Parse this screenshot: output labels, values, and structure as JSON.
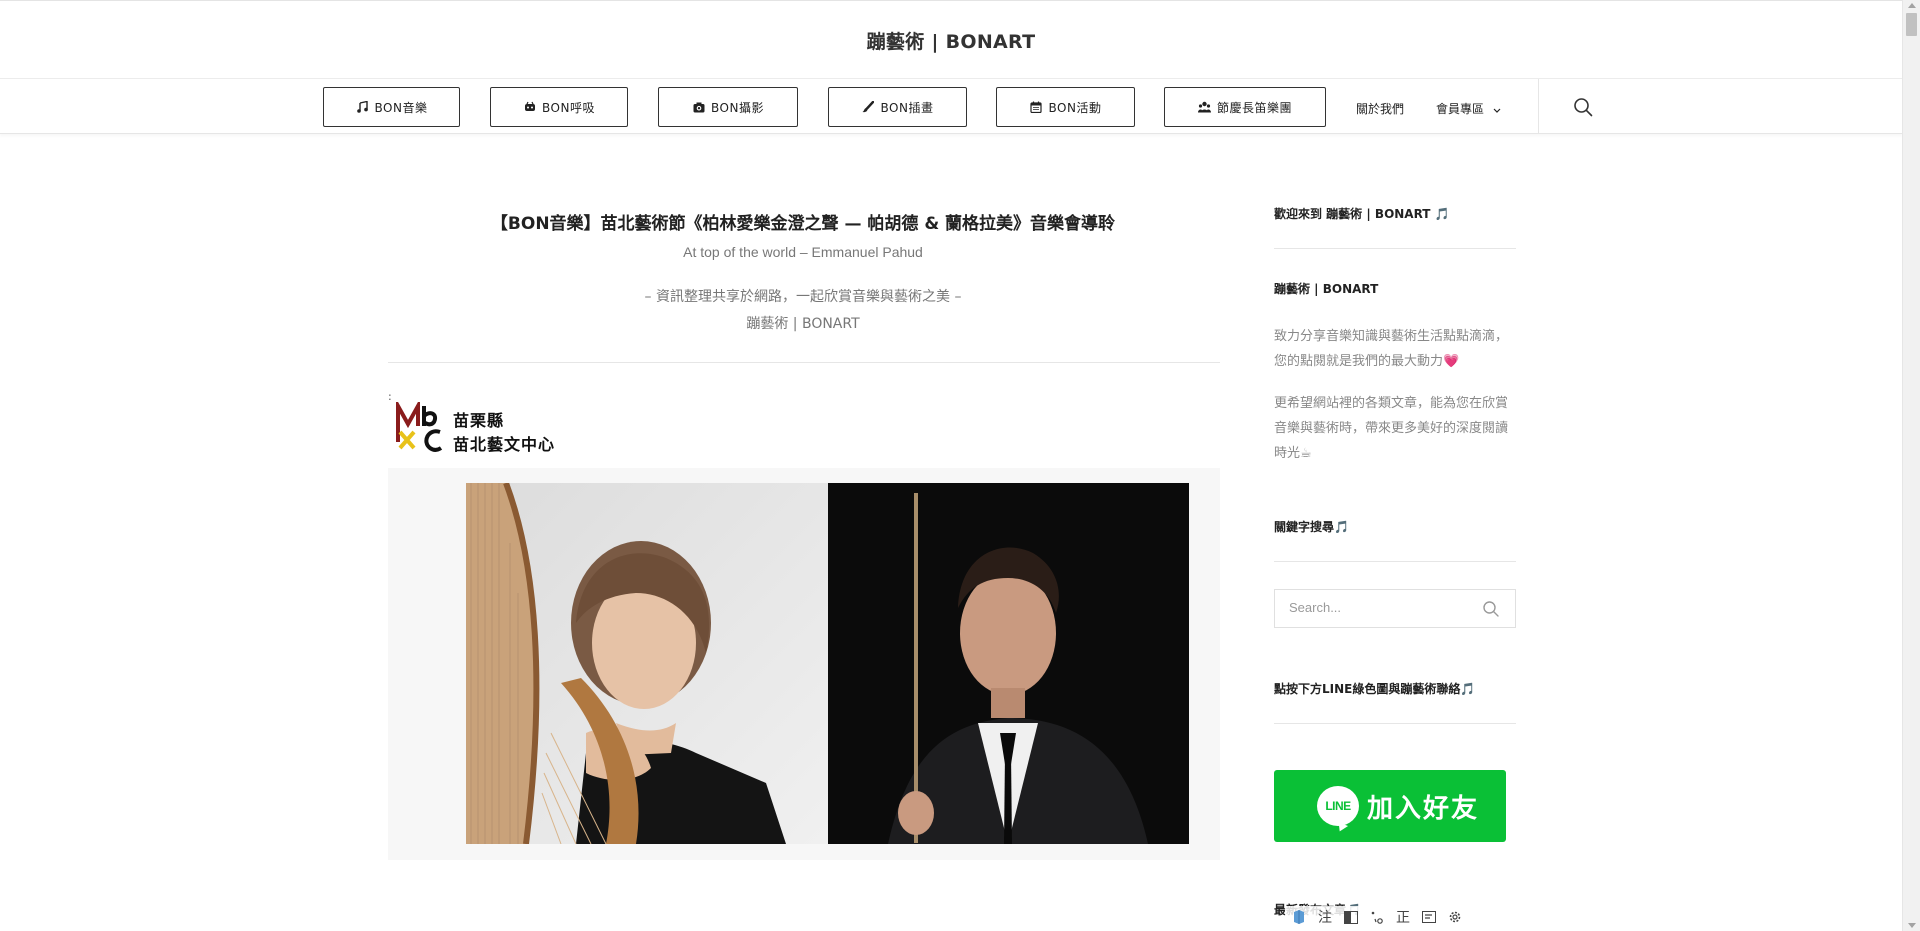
{
  "site": {
    "title": "蹦藝術 | BONART"
  },
  "nav": {
    "buttons": [
      {
        "label": "BON音樂",
        "icon": "music-note-icon"
      },
      {
        "label": "BON呼吸",
        "icon": "spa-icon"
      },
      {
        "label": "BON攝影",
        "icon": "camera-icon"
      },
      {
        "label": "BON插畫",
        "icon": "brush-icon"
      },
      {
        "label": "BON活動",
        "icon": "calendar-icon"
      },
      {
        "label": "節慶長笛樂團",
        "icon": "group-icon"
      }
    ],
    "about": "關於我們",
    "member": "會員專區"
  },
  "post": {
    "title": "【BON音樂】苗北藝術節《柏林愛樂金澄之聲 — 帕胡德 & 蘭格拉美》音樂會導聆",
    "subtitle": "At top of the world – Emmanuel Pahud",
    "tagline": "– 資訊整理共享於網路，一起欣賞音樂與藝術之美 –",
    "signature": "蹦藝術 | BONART",
    "dot1": ":",
    "dot2": ":",
    "logo": {
      "mark": "MbC",
      "line1": "苗栗縣",
      "line2": "苗北藝文中心"
    }
  },
  "sidebar": {
    "welcome": "歡迎來到 蹦藝術 | BONART 🎵",
    "about_title": "蹦藝術 | BONART",
    "about_p1": "致力分享音樂知識與藝術生活點點滴滴，您的點閱就是我們的最大動力💗",
    "about_p2": "更希望網站裡的各類文章，能為您在欣賞音樂與藝術時，帶來更多美好的深度閱讀時光☕",
    "keyword_title": "關鍵字搜尋🎵",
    "search_placeholder": "Search...",
    "line_title": "點按下方LINE綠色圖與蹦藝術聯絡🎵",
    "line_badge": "LINE",
    "line_button": "加入好友",
    "bottom_title": "最新發布文章🎵"
  },
  "ime": {
    "items": [
      "注",
      "正"
    ]
  },
  "colors": {
    "line_green": "#0ac036",
    "accent_blue": "#2aa0d8"
  }
}
